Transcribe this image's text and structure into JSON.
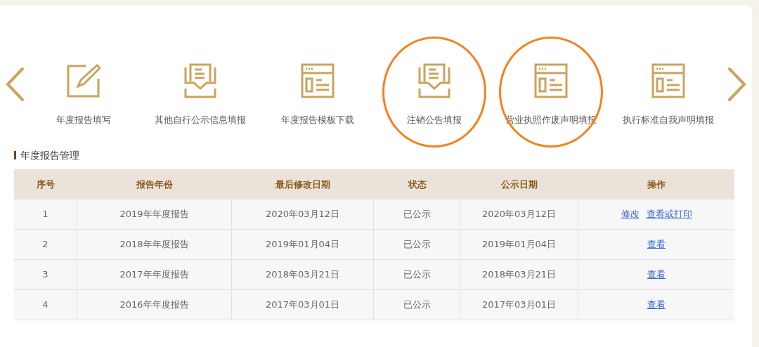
{
  "services": [
    {
      "label": "年度报告填写",
      "kind": "edit",
      "circled": false
    },
    {
      "label": "其他自行公示信息填报",
      "kind": "tray",
      "circled": false
    },
    {
      "label": "年度报告模板下载",
      "kind": "layout",
      "circled": false
    },
    {
      "label": "注销公告填报",
      "kind": "tray",
      "circled": true
    },
    {
      "label": "营业执照作废声明填报",
      "kind": "layout",
      "circled": true
    },
    {
      "label": "执行标准自我声明填报",
      "kind": "layout",
      "circled": false
    }
  ],
  "section_title": "年度报告管理",
  "table": {
    "columns": [
      "序号",
      "报告年份",
      "最后修改日期",
      "状态",
      "公示日期",
      "操作"
    ],
    "rows": [
      {
        "cells": [
          "1",
          "2019年年度报告",
          "2020年03月12日",
          "已公示",
          "2020年03月12日"
        ],
        "actions": [
          "修改",
          "查看或打印"
        ]
      },
      {
        "cells": [
          "2",
          "2018年年度报告",
          "2019年01月04日",
          "已公示",
          "2019年01月04日"
        ],
        "actions": [
          "查看"
        ]
      },
      {
        "cells": [
          "3",
          "2017年年度报告",
          "2018年03月21日",
          "已公示",
          "2018年03月21日"
        ],
        "actions": [
          "查看"
        ]
      },
      {
        "cells": [
          "4",
          "2016年年度报告",
          "2017年03月01日",
          "已公示",
          "2017年03月01日"
        ],
        "actions": [
          "查看"
        ]
      }
    ]
  }
}
